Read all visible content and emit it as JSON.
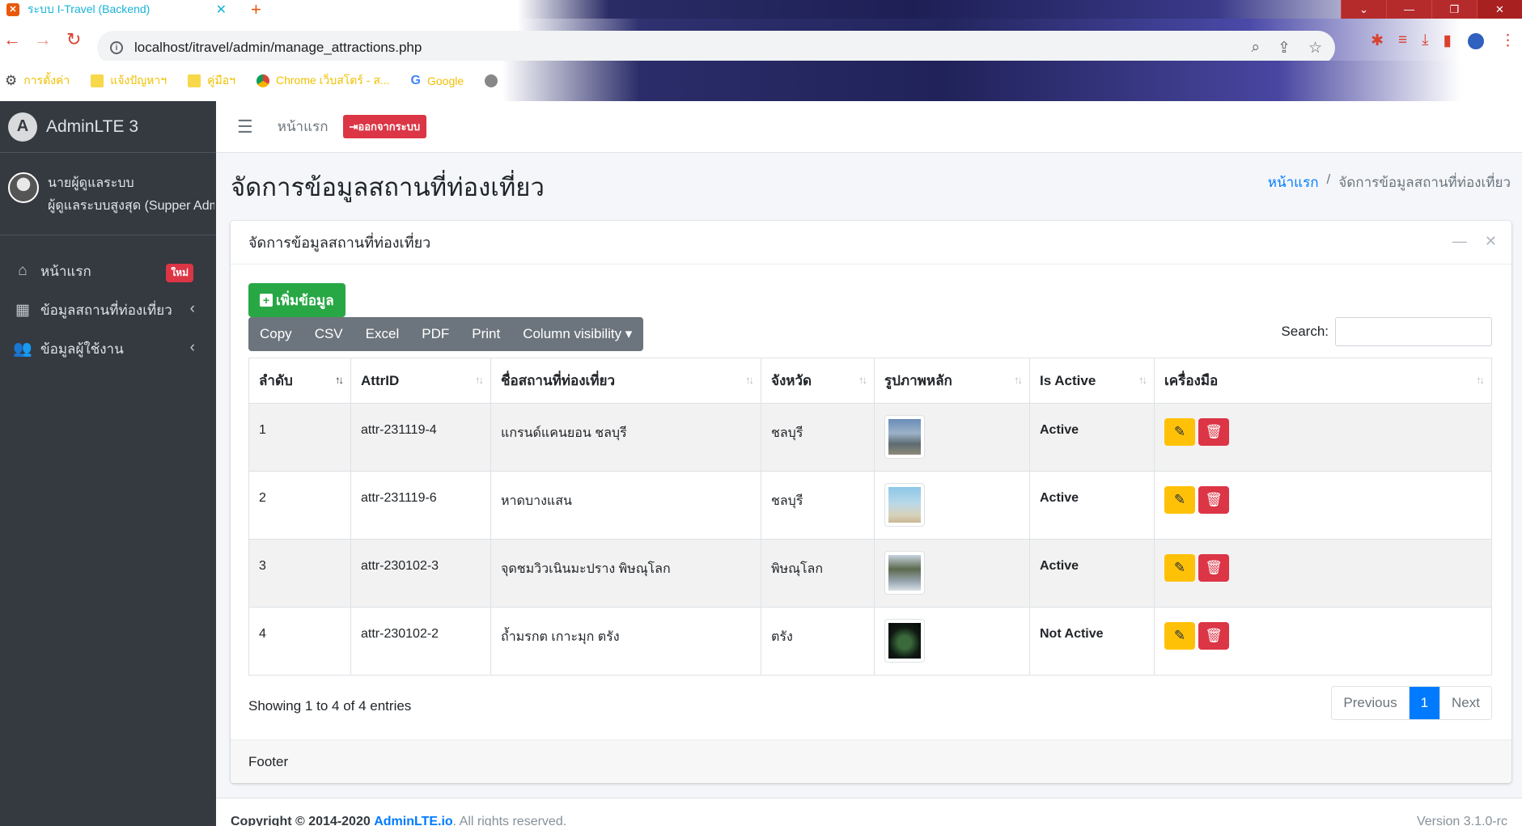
{
  "browser": {
    "tab_title": "ระบบ I-Travel (Backend)",
    "tab_icon": "xampp-icon",
    "url": "localhost/itravel/admin/manage_attractions.php",
    "bookmarks": [
      {
        "label": "การตั้งค่า",
        "icon": "gear-icon"
      },
      {
        "label": "แจ้งปัญหาฯ",
        "icon": "folder-icon"
      },
      {
        "label": "คู่มือฯ",
        "icon": "folder-icon"
      },
      {
        "label": "Chrome เว็บสโตร์ - ส...",
        "icon": "chrome-icon"
      },
      {
        "label": "Google",
        "icon": "google-icon"
      }
    ]
  },
  "sidebar": {
    "brand": "AdminLTE 3",
    "user_name": "นายผู้ดูแลระบบ",
    "user_role": "ผู้ดูแลระบบสูงสุด (Supper Admin)",
    "items": [
      {
        "label": "หน้าแรก",
        "icon": "home-icon",
        "badge": "ใหม่"
      },
      {
        "label": "ข้อมูลสถานที่ท่องเที่ยว",
        "icon": "grid-icon"
      },
      {
        "label": "ข้อมูลผู้ใช้งาน",
        "icon": "users-icon"
      }
    ]
  },
  "navbar": {
    "home": "หน้าแรก",
    "logout": "ออกจากระบบ"
  },
  "header": {
    "title": "จัดการข้อมูลสถานที่ท่องเที่ยว",
    "breadcrumb_home": "หน้าแรก",
    "breadcrumb_sep": "/",
    "breadcrumb_active": "จัดการข้อมูลสถานที่ท่องเที่ยว"
  },
  "card": {
    "title": "จัดการข้อมูลสถานที่ท่องเที่ยว",
    "add_button": "เพิ่มข้อมูล",
    "export_buttons": [
      "Copy",
      "CSV",
      "Excel",
      "PDF",
      "Print",
      "Column visibility ▾"
    ],
    "search_label": "Search:",
    "search_value": "",
    "columns": [
      "ลำดับ",
      "AttrID",
      "ชื่อสถานที่ท่องเที่ยว",
      "จังหวัด",
      "รูปภาพหลัก",
      "Is Active",
      "เครื่องมือ"
    ],
    "rows": [
      {
        "no": "1",
        "id": "attr-231119-4",
        "name": "แกรนด์แคนยอน ชลบุรี",
        "province": "ชลบุรี",
        "active": "Active"
      },
      {
        "no": "2",
        "id": "attr-231119-6",
        "name": "หาดบางแสน",
        "province": "ชลบุรี",
        "active": "Active"
      },
      {
        "no": "3",
        "id": "attr-230102-3",
        "name": "จุดชมวิวเนินมะปราง พิษณุโลก",
        "province": "พิษณุโลก",
        "active": "Active"
      },
      {
        "no": "4",
        "id": "attr-230102-2",
        "name": "ถ้ำมรกต เกาะมุก ตรัง",
        "province": "ตรัง",
        "active": "Not Active"
      }
    ],
    "info": "Showing 1 to 4 of 4 entries",
    "pagination": {
      "previous": "Previous",
      "current": "1",
      "next": "Next"
    },
    "footer": "Footer"
  },
  "footer": {
    "copyright_prefix": "Copyright © 2014-2020",
    "copyright_link": "AdminLTE.io",
    "copyright_suffix": ". All rights reserved.",
    "version": "Version 3.1.0-rc"
  }
}
